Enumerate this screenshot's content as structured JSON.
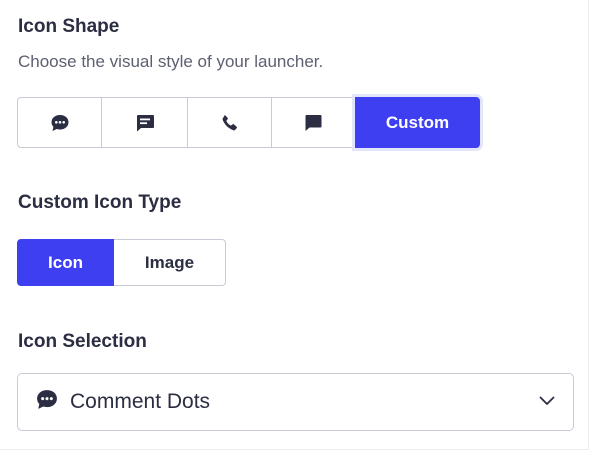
{
  "icon_shape": {
    "title": "Icon Shape",
    "description": "Choose the visual style of your launcher.",
    "options": [
      {
        "icon": "comment-dots-icon"
      },
      {
        "icon": "message-lines-icon"
      },
      {
        "icon": "phone-icon"
      },
      {
        "icon": "message-square-icon"
      },
      {
        "label": "Custom",
        "selected": true
      }
    ]
  },
  "custom_icon_type": {
    "title": "Custom Icon Type",
    "options": [
      {
        "label": "Icon",
        "selected": true
      },
      {
        "label": "Image",
        "selected": false
      }
    ]
  },
  "icon_selection": {
    "title": "Icon Selection",
    "selected_icon": "comment-dots-icon",
    "selected_label": "Comment Dots",
    "dropdown_icon": "chevron-down-icon"
  },
  "colors": {
    "accent": "#3e3ff0",
    "text": "#2b2d42",
    "muted": "#5d6071",
    "border": "#c9cbd4"
  }
}
